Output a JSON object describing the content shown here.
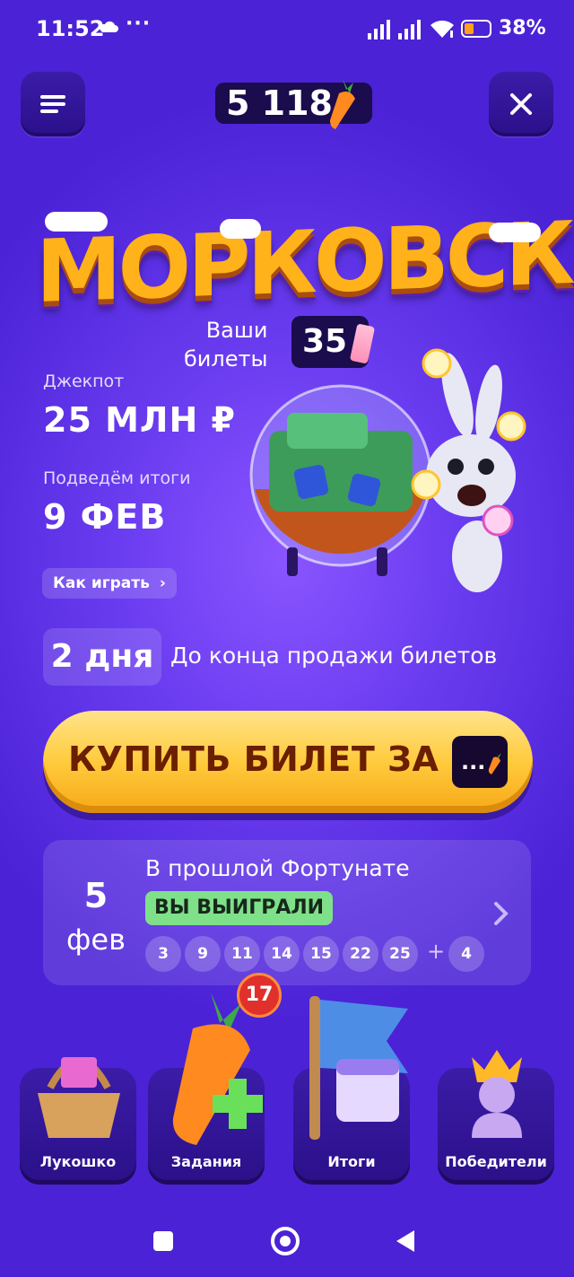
{
  "status_bar": {
    "time": "11:52",
    "dots": "···",
    "battery": "38%"
  },
  "header": {
    "balance": "5 118"
  },
  "logo": {
    "text": "МОРКОВСК"
  },
  "tickets": {
    "label": "Ваши\nбилеты",
    "count": "35"
  },
  "jackpot": {
    "label": "Джекпот",
    "value": "25 МЛН ₽"
  },
  "results": {
    "label": "Подведём итоги",
    "value": "9 ФЕВ"
  },
  "how_to_play": {
    "label": "Как играть"
  },
  "days_left": {
    "value": "2 дня",
    "text": "До конца продажи билетов"
  },
  "buy_button": {
    "label": "КУПИТЬ БИЛЕТ ЗА",
    "price": "..."
  },
  "last_draw": {
    "day": "5",
    "month": "фев",
    "title": "В прошлой Фортунате",
    "status": "ВЫ ВЫИГРАЛИ",
    "numbers": [
      "3",
      "9",
      "11",
      "14",
      "15",
      "22",
      "25"
    ],
    "plus": "+",
    "bonus": "4"
  },
  "menu": {
    "basket": "Лукошко",
    "tasks": "Задания",
    "tasks_badge": "17",
    "results": "Итоги",
    "winners": "Победители"
  },
  "colors": {
    "accent": "#ffcb3d",
    "background": "#5a2ee8",
    "won": "#7fe08a",
    "badge": "#e0302b"
  }
}
